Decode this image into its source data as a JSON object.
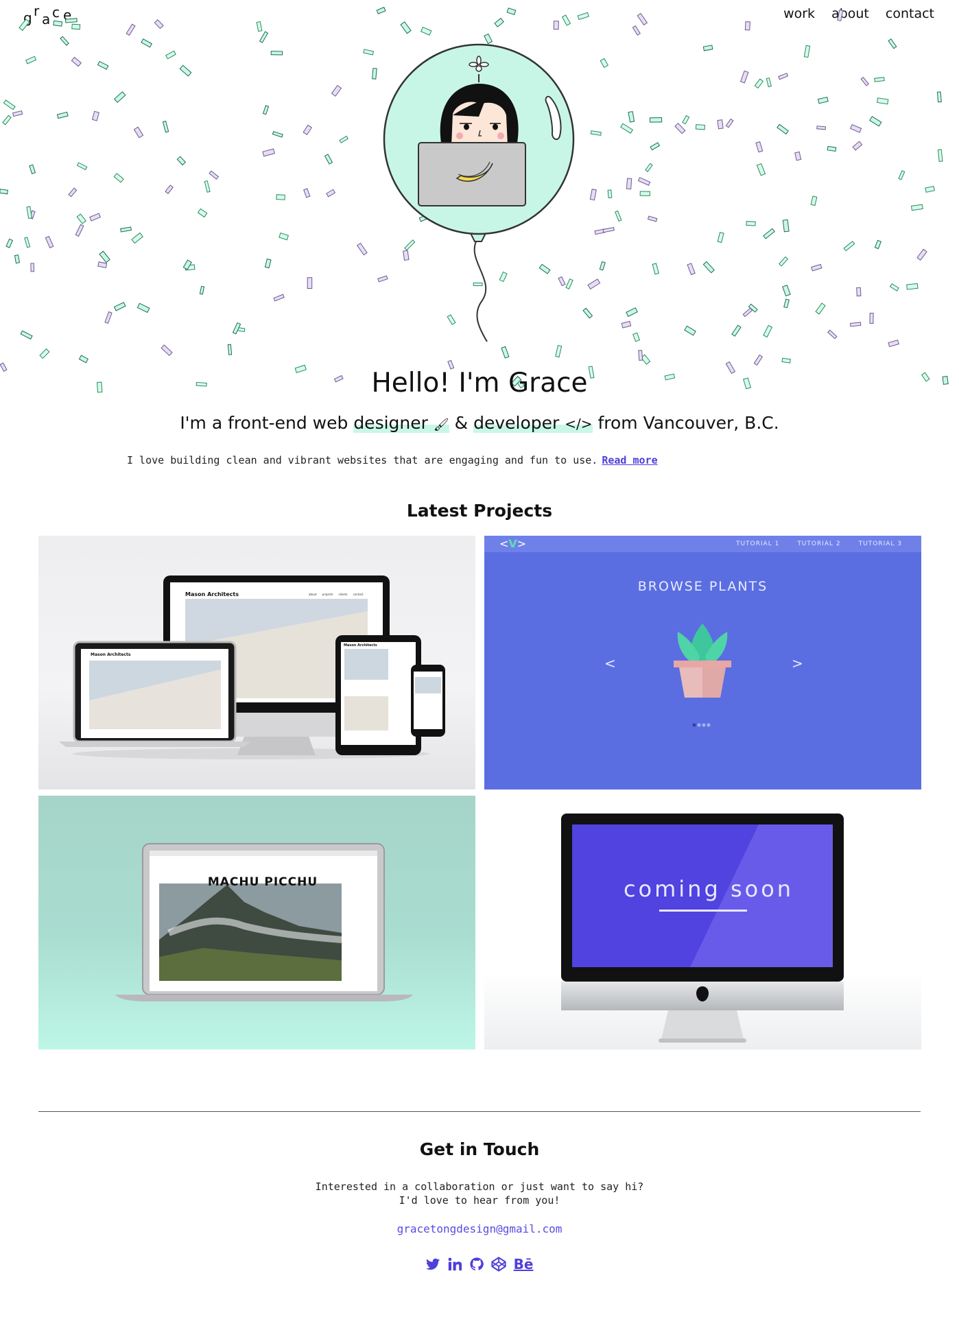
{
  "logo": {
    "letters": [
      "g",
      "r",
      "a",
      "c",
      "e"
    ]
  },
  "nav": {
    "work": "work",
    "about": "about",
    "contact": "contact"
  },
  "hero": {
    "title": "Hello! I'm Grace",
    "subtitle_pre": "I'm a front-end web ",
    "designer": "designer",
    "designer_icon": "🖌",
    "amp": " & ",
    "developer": "developer",
    "developer_icon": "</>",
    "subtitle_post": " from Vancouver, B.C.",
    "description": "I love building clean and vibrant websites that are engaging and fun to use.",
    "read_more": "Read more"
  },
  "projects": {
    "title": "Latest Projects",
    "mason": {
      "brand": "Mason Architects",
      "nav": [
        "about",
        "projects",
        "clients",
        "contact"
      ]
    },
    "plants": {
      "tabs": [
        "TUTORIAL 1",
        "TUTORIAL 2",
        "TUTORIAL 3"
      ],
      "title": "BROWSE PLANTS",
      "prev": "<",
      "next": ">"
    },
    "machu": {
      "title": "MACHU PICCHU"
    },
    "coming": {
      "text": "coming soon"
    }
  },
  "contact": {
    "title": "Get in Touch",
    "line1": "Interested in a collaboration or just want to say hi?",
    "line2": "I'd love to hear from you!",
    "email": "gracetongdesign@gmail.com",
    "socials": [
      "twitter-icon",
      "linkedin-icon",
      "github-icon",
      "codepen-icon",
      "behance-icon"
    ],
    "behance_label": "Bē"
  },
  "colors": {
    "accent": "#4f3fdb",
    "mint": "#c9f7e7",
    "plants_bg": "#5b6ee1",
    "coming_screen": "#5043e0"
  }
}
